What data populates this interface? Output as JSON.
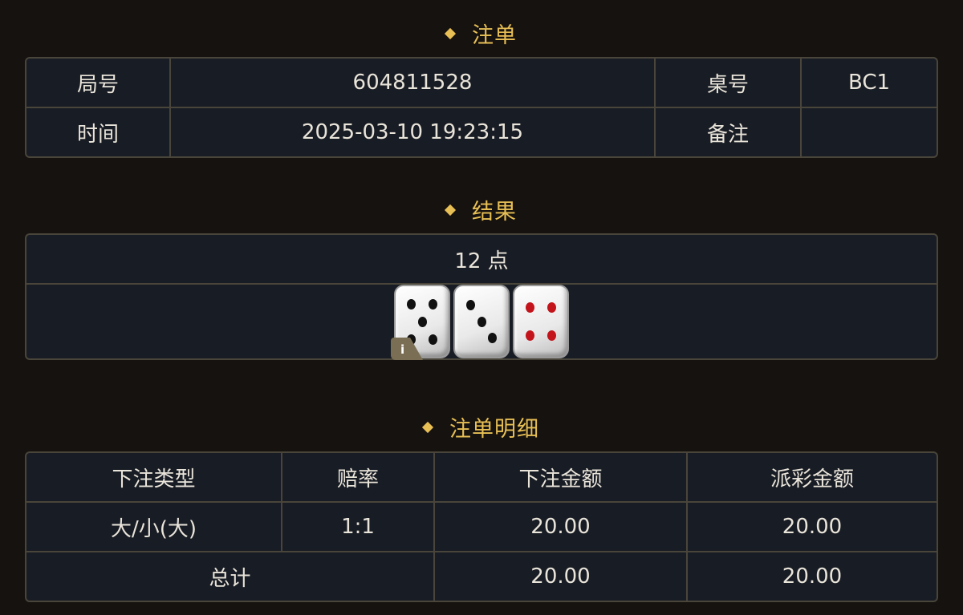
{
  "order": {
    "title": "注单",
    "round_label": "局号",
    "round_value": "604811528",
    "table_label": "桌号",
    "table_value": "BC1",
    "time_label": "时间",
    "time_value": "2025-03-10 19:23:15",
    "remark_label": "备注",
    "remark_value": ""
  },
  "result": {
    "title": "结果",
    "points": "12 点",
    "dice": [
      5,
      3,
      4
    ],
    "info_icon": "info-icon",
    "info_text": "i"
  },
  "detail": {
    "title": "注单明细",
    "headers": [
      "下注类型",
      "赔率",
      "下注金额",
      "派彩金额"
    ],
    "rows": [
      {
        "type": "大/小(大)",
        "odds": "1:1",
        "bet": "20.00",
        "payout": "20.00"
      }
    ],
    "total": {
      "label": "总计",
      "bet": "20.00",
      "payout": "20.00"
    }
  },
  "colors": {
    "accent": "#e7bf55",
    "odds": "#cc1f22",
    "background": "#16120f",
    "panel": "#181c24",
    "border": "#4a453a"
  }
}
